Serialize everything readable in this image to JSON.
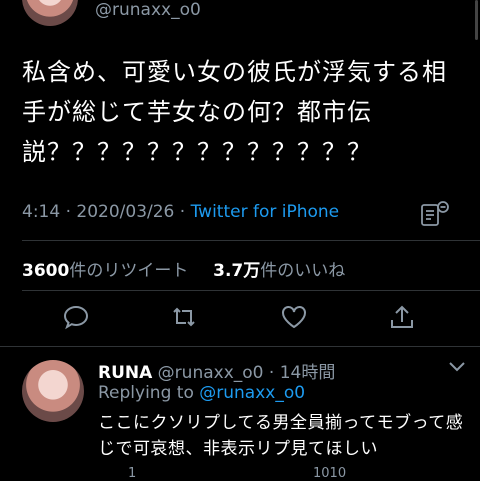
{
  "tweet": {
    "handle": "@runaxx_o0",
    "text": "私含め、可愛い女の彼氏が浮気する相手が総じて芋女なの何？都市伝説？？？？？？？？？？？？？",
    "time": "4:14 · 2020/03/26 · ",
    "source": "Twitter for iPhone",
    "retweets_count": "3600",
    "retweets_label": "件のリツイート",
    "likes_count": "3.7万",
    "likes_label": "件のいいね"
  },
  "reply": {
    "name": "RUNA",
    "handle_time": " @runaxx_o0 · 14時間",
    "replying_prefix": "Replying to ",
    "replying_handle": "@runaxx_o0",
    "text": "ここにクソリプしてる男全員揃ってモブって感じで可哀想、非表示リプ見てほしい",
    "partial_counts": [
      "1",
      "1010"
    ]
  },
  "icons": {
    "reply": "reply-icon",
    "retweet": "retweet-icon",
    "like": "heart-icon",
    "share": "share-icon",
    "analytics": "analytics-icon",
    "more": "chevron-down-icon"
  },
  "colors": {
    "background": "#000000",
    "text": "#ffffff",
    "secondary": "#8b98a5",
    "link": "#1d9bf0",
    "divider": "#2f3336"
  }
}
